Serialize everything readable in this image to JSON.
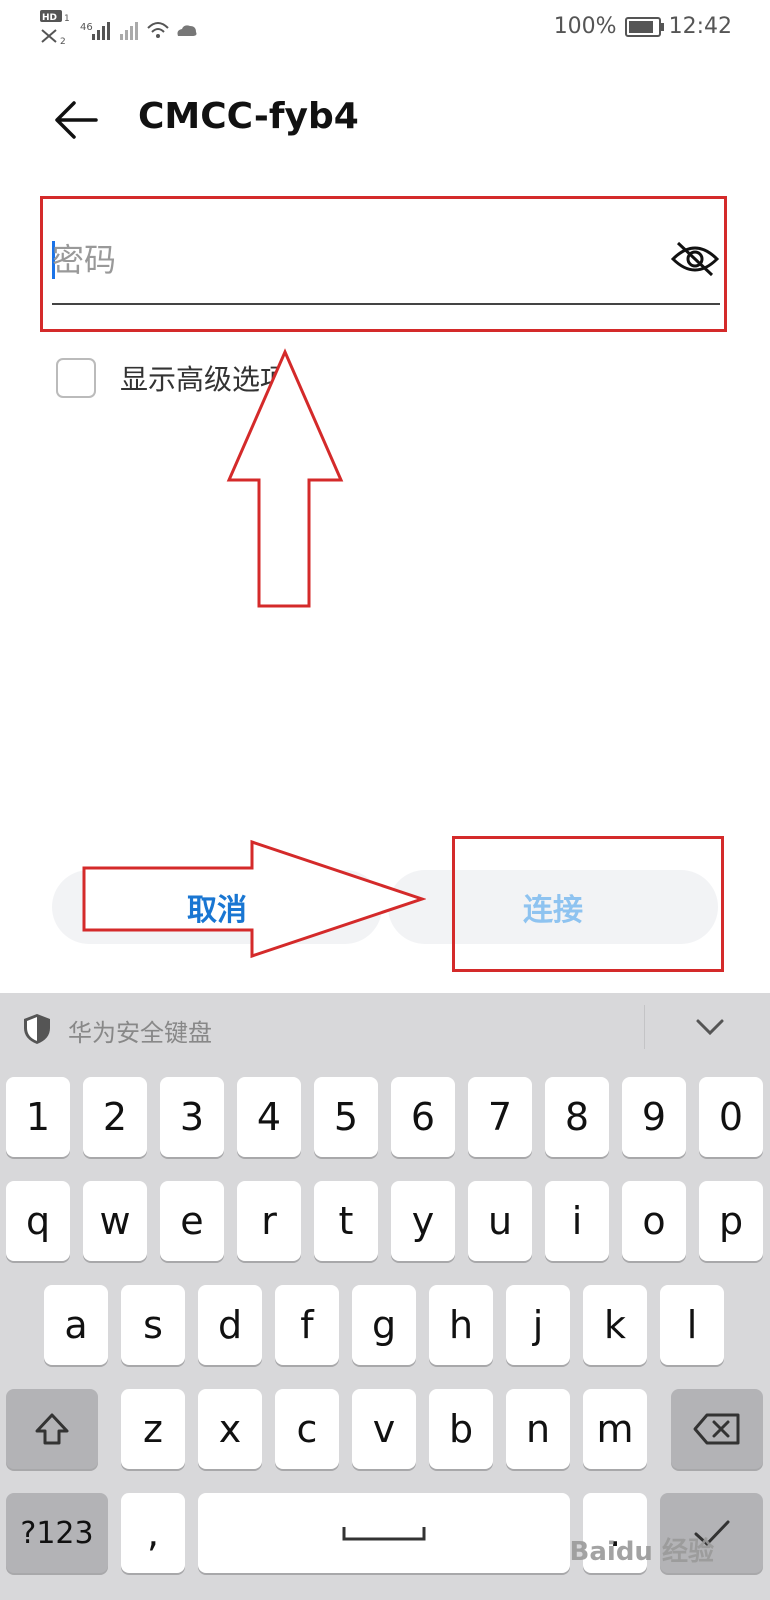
{
  "status_bar": {
    "left_indicators": [
      "HD1",
      "46",
      "HD2"
    ],
    "battery_percent": "100%",
    "battery_level": 1.0,
    "time": "12:42"
  },
  "header": {
    "back_icon": "arrow-left-icon",
    "title": "CMCC-fyb4"
  },
  "password": {
    "placeholder": "密码",
    "value": "",
    "toggle_icon": "eye-off-icon"
  },
  "advanced": {
    "label": "显示高级选项",
    "checked": false
  },
  "buttons": {
    "cancel_label": "取消",
    "connect_label": "连接"
  },
  "keyboard": {
    "name": "华为安全键盘",
    "shield_icon": "shield-icon",
    "collapse_icon": "chevron-down-icon",
    "rows": [
      [
        "1",
        "2",
        "3",
        "4",
        "5",
        "6",
        "7",
        "8",
        "9",
        "0"
      ],
      [
        "q",
        "w",
        "e",
        "r",
        "t",
        "y",
        "u",
        "i",
        "o",
        "p"
      ],
      [
        "a",
        "s",
        "d",
        "f",
        "g",
        "h",
        "j",
        "k",
        "l"
      ],
      [
        "z",
        "x",
        "c",
        "v",
        "b",
        "n",
        "m"
      ]
    ],
    "shift_icon": "shift-icon",
    "backspace_icon": "backspace-icon",
    "symbols_label": "?123",
    "comma_label": ",",
    "space_icon": "space-bar-icon",
    "enter_icon": "check-icon"
  },
  "annotations": {
    "highlight_color": "#d42a2a"
  },
  "watermark": "Baidu 经验"
}
